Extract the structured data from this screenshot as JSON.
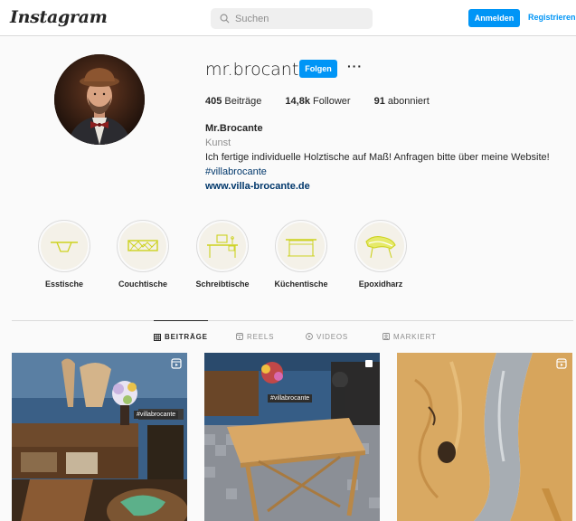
{
  "header": {
    "logo": "Instagram",
    "search_placeholder": "Suchen",
    "login_label": "Anmelden",
    "register_label": "Registrieren"
  },
  "profile": {
    "username": "mr.brocante",
    "follow_label": "Folgen",
    "more_label": "···",
    "stats": [
      {
        "count": "405",
        "label": "Beiträge"
      },
      {
        "count": "14,8k",
        "label": "Follower"
      },
      {
        "count": "91",
        "label": "abonniert"
      }
    ],
    "bio": {
      "name": "Mr.Brocante",
      "category": "Kunst",
      "text": "Ich fertige individuelle Holztische auf Maß! Anfragen bitte über meine Website!",
      "hashtag": "#villabrocante",
      "website": "www.villa-brocante.de"
    }
  },
  "highlights": [
    {
      "label": "Esstische",
      "icon": "dining-table-icon"
    },
    {
      "label": "Couchtische",
      "icon": "coffee-table-icon"
    },
    {
      "label": "Schreibtische",
      "icon": "desk-icon"
    },
    {
      "label": "Küchentische",
      "icon": "kitchen-table-icon"
    },
    {
      "label": "Epoxidharz",
      "icon": "epoxy-table-icon"
    }
  ],
  "tabs": [
    {
      "label": "BEITRÄGE",
      "icon": "grid-icon",
      "active": true
    },
    {
      "label": "REELS",
      "icon": "reels-icon",
      "active": false
    },
    {
      "label": "VIDEOS",
      "icon": "play-icon",
      "active": false
    },
    {
      "label": "MARKIERT",
      "icon": "tagged-icon",
      "active": false
    }
  ],
  "posts": [
    {
      "sign_text": "#villabrocante",
      "badge": "reel-icon"
    },
    {
      "sign_text": "#villabrocante",
      "badge": "carousel-icon"
    },
    {
      "sign_text": "",
      "badge": "reel-icon"
    }
  ],
  "colors": {
    "accent": "#0095f6",
    "highlight_line": "#d6dc2a",
    "link": "#00376b"
  }
}
